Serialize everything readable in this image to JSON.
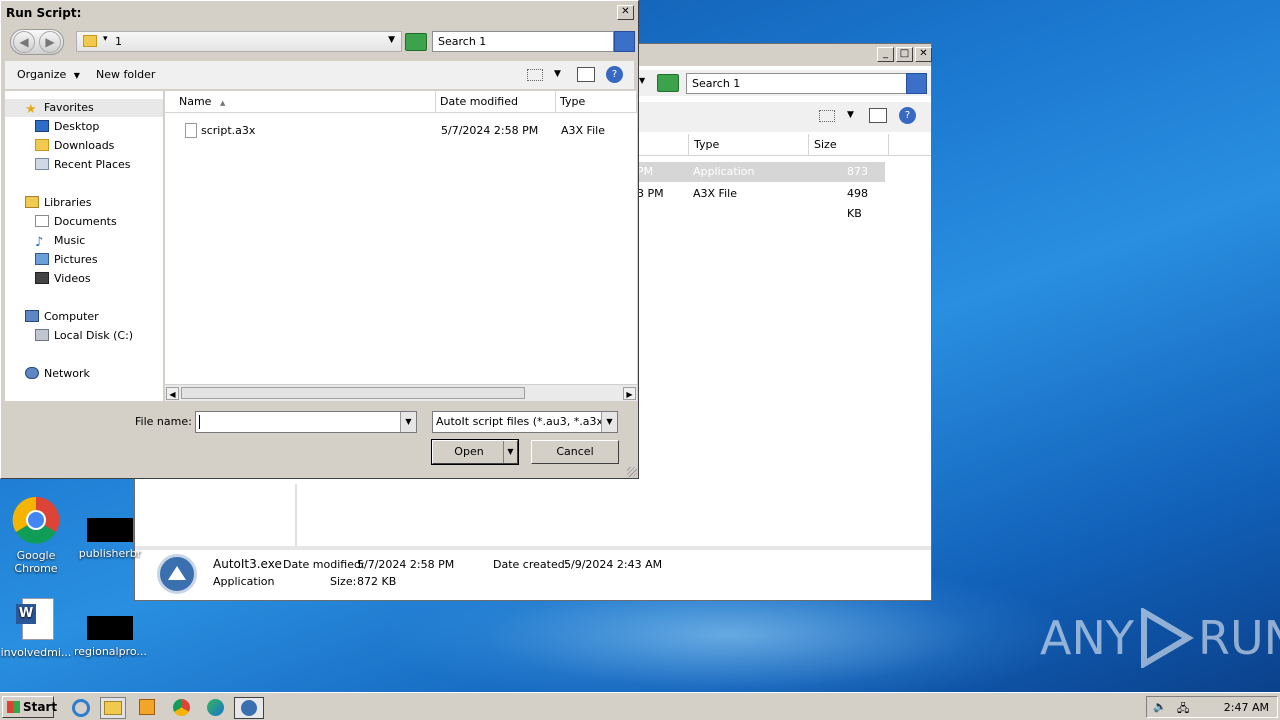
{
  "dialog": {
    "title": "Run Script:",
    "close_glyph": "✕",
    "address_path": "1",
    "search_placeholder": "Search 1",
    "toolbar": {
      "organize": "Organize",
      "new_folder": "New folder"
    },
    "nav": {
      "favorites": "Favorites",
      "desktop": "Desktop",
      "downloads": "Downloads",
      "recent_places": "Recent Places",
      "libraries": "Libraries",
      "documents": "Documents",
      "music": "Music",
      "pictures": "Pictures",
      "videos": "Videos",
      "computer": "Computer",
      "local_disk": "Local Disk (C:)",
      "network": "Network"
    },
    "columns": {
      "name": "Name",
      "date_modified": "Date modified",
      "type": "Type"
    },
    "files": [
      {
        "name": "script.a3x",
        "date": "5/7/2024 2:58 PM",
        "type": "A3X File"
      }
    ],
    "file_name_label": "File name:",
    "file_name_value": "",
    "file_type": "AutoIt script files (*.au3, *.a3x)",
    "open_label": "Open",
    "cancel_label": "Cancel"
  },
  "bg_window": {
    "search_placeholder": "Search 1",
    "columns": {
      "type": "Type",
      "size": "Size"
    },
    "rows": [
      {
        "date_tail": "PM",
        "type": "Application",
        "size": "873 KB",
        "selected": true
      },
      {
        "date_tail": "3 PM",
        "type": "A3X File",
        "size": "498 KB",
        "selected": false
      }
    ],
    "details": {
      "name": "AutoIt3.exe",
      "kind": "Application",
      "date_modified_label": "Date modified:",
      "date_modified": "5/7/2024 2:58 PM",
      "size_label": "Size:",
      "size": "872 KB",
      "date_created_label": "Date created:",
      "date_created": "5/9/2024 2:43 AM"
    }
  },
  "desktop": {
    "icons": [
      {
        "label": "Google Chrome",
        "icon": "chrome-icon"
      },
      {
        "label": "publisherbr",
        "icon": "black-thumbnail"
      },
      {
        "label": "involvedmi...",
        "icon": "word-document-icon"
      },
      {
        "label": "regionalpro...",
        "icon": "black-thumbnail"
      }
    ],
    "watermark": {
      "left": "ANY",
      "right": "RUN"
    }
  },
  "taskbar": {
    "start_label": "Start",
    "clock": "2:47 AM",
    "pinned": [
      "internet-explorer-icon",
      "explorer-icon",
      "media-player-icon",
      "chrome-icon",
      "edge-icon",
      "autoit-icon"
    ]
  },
  "colors": {
    "desktop_blue": "#1b78cf",
    "chrome_gray": "#d4d0c8",
    "selection_gray": "#d6d6d6",
    "autoit_blue": "#3a6fb0"
  }
}
